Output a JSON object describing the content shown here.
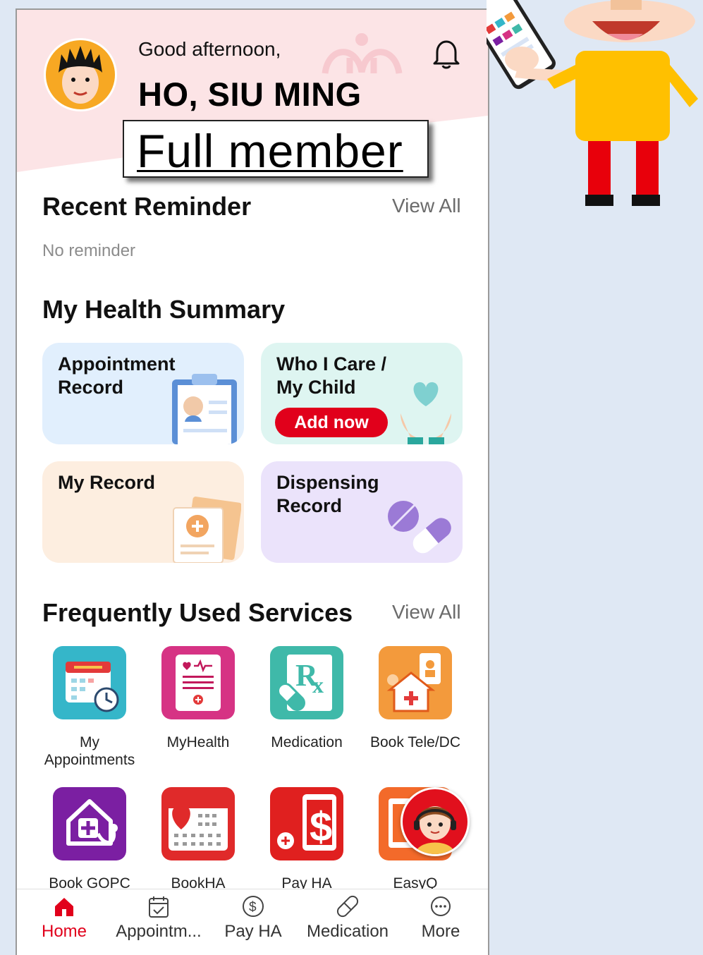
{
  "header": {
    "greeting": "Good afternoon,",
    "user_name": "HO, SIU MING",
    "membership": "Full member"
  },
  "reminder": {
    "title": "Recent Reminder",
    "view_all": "View All",
    "empty_text": "No reminder"
  },
  "health_summary": {
    "title": "My Health Summary",
    "cards": [
      {
        "label": "Appointment Record"
      },
      {
        "label": "Who I Care / My Child",
        "action": "Add now"
      },
      {
        "label": "My Record"
      },
      {
        "label": "Dispensing Record"
      }
    ]
  },
  "services": {
    "title": "Frequently Used Services",
    "view_all": "View All",
    "items": [
      {
        "label": "My Appointments",
        "icon": "calendar-clock-icon"
      },
      {
        "label": "MyHealth",
        "icon": "health-record-icon"
      },
      {
        "label": "Medication",
        "icon": "rx-pill-icon"
      },
      {
        "label": "Book Tele/DC",
        "icon": "telehealth-house-icon"
      },
      {
        "label": "Book GOPC",
        "icon": "clinic-stethoscope-icon"
      },
      {
        "label": "BookHA",
        "icon": "calendar-heart-icon"
      },
      {
        "label": "Pay HA",
        "icon": "payment-dollar-icon"
      },
      {
        "label": "EasyQ",
        "icon": "queue-icon"
      }
    ]
  },
  "tabbar": {
    "items": [
      {
        "label": "Home",
        "icon": "home-icon",
        "active": true
      },
      {
        "label": "Appointm...",
        "icon": "calendar-check-icon"
      },
      {
        "label": "Pay HA",
        "icon": "dollar-circle-icon"
      },
      {
        "label": "Medication",
        "icon": "pill-icon"
      },
      {
        "label": "More",
        "icon": "more-dots-icon"
      }
    ]
  },
  "colors": {
    "accent": "#e1001b",
    "header_bg": "#fce4e6",
    "page_bg": "#dfe8f4"
  }
}
